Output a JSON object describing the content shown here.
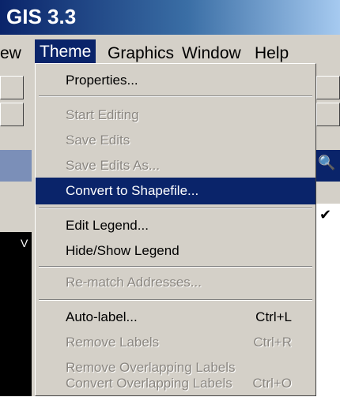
{
  "app": {
    "title": "GIS 3.3"
  },
  "menubar": [
    {
      "label": "ew",
      "u": ""
    },
    {
      "label": "Theme",
      "u": "T",
      "active": true
    },
    {
      "label": "Graphics",
      "u": "G"
    },
    {
      "label": "Window",
      "u": "W"
    },
    {
      "label": "Help",
      "u": "H"
    }
  ],
  "menu": {
    "items": [
      {
        "label": "Properties...",
        "enabled": true
      },
      {
        "label": "Start Editing",
        "enabled": false
      },
      {
        "label": "Save Edits",
        "enabled": false
      },
      {
        "label": "Save Edits As...",
        "enabled": false
      },
      {
        "label": "Convert to Shapefile...",
        "enabled": true,
        "highlighted": true
      },
      {
        "label": "Edit Legend...",
        "enabled": true
      },
      {
        "label": "Hide/Show Legend",
        "enabled": true
      },
      {
        "label": "Re-match Addresses...",
        "enabled": false
      },
      {
        "label": "Auto-label...",
        "enabled": true,
        "shortcut": "Ctrl+L"
      },
      {
        "label": "Remove Labels",
        "enabled": false,
        "shortcut": "Ctrl+R"
      },
      {
        "label": "Remove Overlapping Labels",
        "enabled": false
      },
      {
        "label": "Convert Overlapping Labels",
        "enabled": false,
        "shortcut": "Ctrl+O"
      }
    ]
  },
  "side": {
    "right_letter": "V",
    "left_letter": "V",
    "check": "✔"
  }
}
